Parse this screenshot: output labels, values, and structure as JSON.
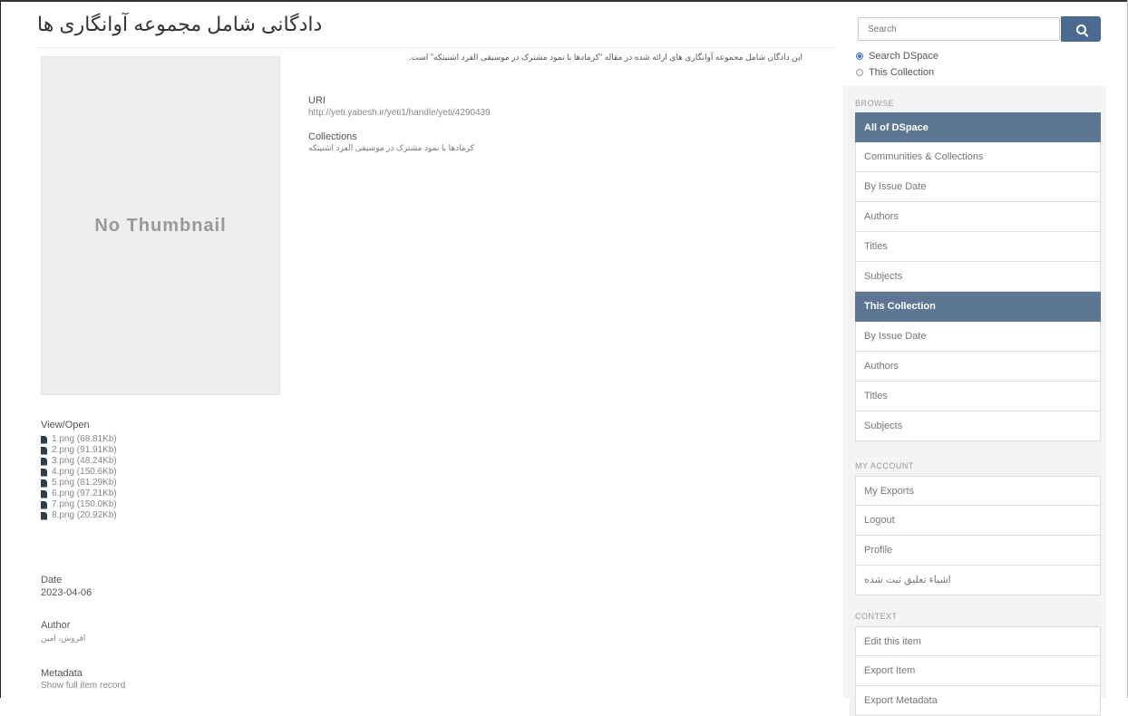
{
  "page": {
    "title": "دادگانی شامل مجموعه آوانگاری ها",
    "thumbnail_text": "No Thumbnail",
    "description": "این دادگان شامل مجموعه آوانگاری های ارائه شده در مقاله \"کرمادها با نمود مشترک در موسیقی الفرد اشنیتکه\" است.",
    "uri_label": "URI",
    "uri_value": "http://yeti.yabesh.ir/yeti1/handle/yeti/4290439",
    "collections_label": "Collections",
    "collections_value": "کرمادها با نمود مشترک در موسیقی الفرد اشنیتکه",
    "view_open_label": "View/Open",
    "files": [
      {
        "name": "1.png (68.81Kb)"
      },
      {
        "name": "2.png (91.91Kb)"
      },
      {
        "name": "3.png (48.24Kb)"
      },
      {
        "name": "4.png (150.6Kb)"
      },
      {
        "name": "5.png (81.29Kb)"
      },
      {
        "name": "6.png (97.21Kb)"
      },
      {
        "name": "7.png (150.0Kb)"
      },
      {
        "name": "8.png (20.92Kb)"
      }
    ],
    "date_label": "Date",
    "date_value": "2023-04-06",
    "author_label": "Author",
    "author_value": "افزوش، امین",
    "metadata_label": "Metadata",
    "metadata_value": "Show full item record"
  },
  "sidebar": {
    "search_placeholder": "Search",
    "scope_options": [
      {
        "label": "Search DSpace",
        "checked": true
      },
      {
        "label": "This Collection",
        "checked": false
      }
    ],
    "browse_title": "BROWSE",
    "browse_items": [
      {
        "label": "All of DSpace",
        "active": true
      },
      {
        "label": "Communities & Collections"
      },
      {
        "label": "By Issue Date"
      },
      {
        "label": "Authors"
      },
      {
        "label": "Titles"
      },
      {
        "label": "Subjects"
      },
      {
        "label": "This Collection",
        "active": true
      },
      {
        "label": "By Issue Date"
      },
      {
        "label": "Authors"
      },
      {
        "label": "Titles"
      },
      {
        "label": "Subjects"
      }
    ],
    "account_title": "MY ACCOUNT",
    "account_items": [
      {
        "label": "My Exports"
      },
      {
        "label": "Logout"
      },
      {
        "label": "Profile"
      },
      {
        "label": "اشیاء تعلیق ثبت شده"
      }
    ],
    "context_title": "CONTEXT",
    "context_items": [
      {
        "label": "Edit this item"
      },
      {
        "label": "Export Item"
      },
      {
        "label": "Export Metadata"
      }
    ]
  },
  "colors": {
    "active_nav": "#5c7693",
    "search_button": "#4a6a8f"
  }
}
